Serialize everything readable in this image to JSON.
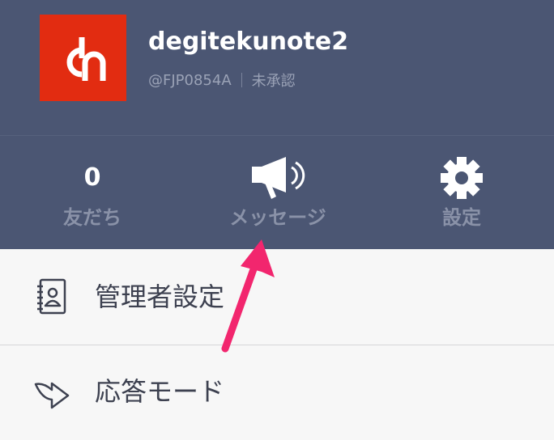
{
  "account": {
    "name": "degitekunote2",
    "id": "@FJP0854A",
    "status": "未承認",
    "logo_icon": "dn-logo-icon",
    "logo_color": "#e22c11"
  },
  "stats": {
    "friends": {
      "count": "0",
      "label": "友だち"
    },
    "message": {
      "label": "メッセージ",
      "icon": "megaphone-icon"
    },
    "settings": {
      "label": "設定",
      "icon": "gear-icon"
    }
  },
  "menu": {
    "items": [
      {
        "label": "管理者設定",
        "icon": "address-book-icon"
      },
      {
        "label": "応答モード",
        "icon": "reply-arrow-icon"
      }
    ]
  },
  "colors": {
    "header_bg": "#4b5673",
    "annotation": "#f2266e"
  }
}
